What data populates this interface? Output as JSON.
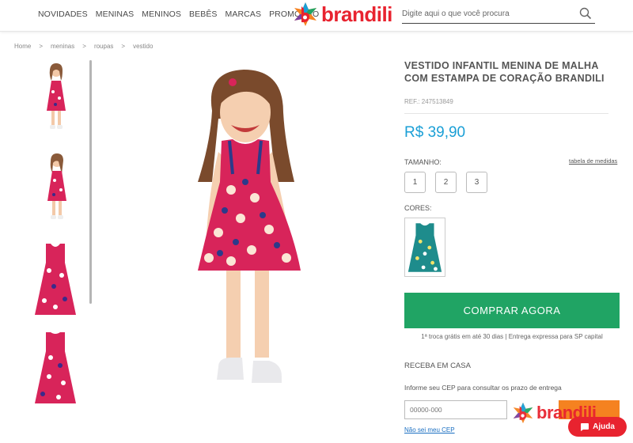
{
  "header": {
    "nav": [
      "NOVIDADES",
      "MENINAS",
      "MENINOS",
      "BEBÊS",
      "MARCAS",
      "PROMOÇÃO"
    ],
    "logo_text": "brandili",
    "search_placeholder": "Digite aqui o que você procura"
  },
  "breadcrumb": [
    "Home",
    ">",
    "meninas",
    ">",
    "roupas",
    ">",
    "vestido"
  ],
  "product": {
    "title": "VESTIDO INFANTIL MENINA DE MALHA COM ESTAMPA DE CORAÇÃO BRANDILI",
    "ref": "REF.: 247513849",
    "price": "R$ 39,90",
    "size_label": "TAMANHO:",
    "size_table_link": "tabela de medidas",
    "sizes": [
      "1",
      "2",
      "3"
    ],
    "colors_label": "CORES:",
    "buy_label": "COMPRAR AGORA",
    "shipping_note": "1ª troca grátis em até 30 dias | Entrega expressa para SP capital",
    "receive_label": "RECEBA EM CASA",
    "cep_info": "Informe seu CEP para consultar os prazo de entrega",
    "cep_placeholder": "00000-000",
    "no_cep_link": "Não sei meu CEP"
  },
  "watermark": {
    "logo_text": "brandili"
  },
  "help_label": "Ajuda",
  "colors": {
    "brand_red": "#e8232f",
    "price_blue": "#1a9fd6",
    "buy_green": "#20a464",
    "cep_orange": "#f58220"
  }
}
